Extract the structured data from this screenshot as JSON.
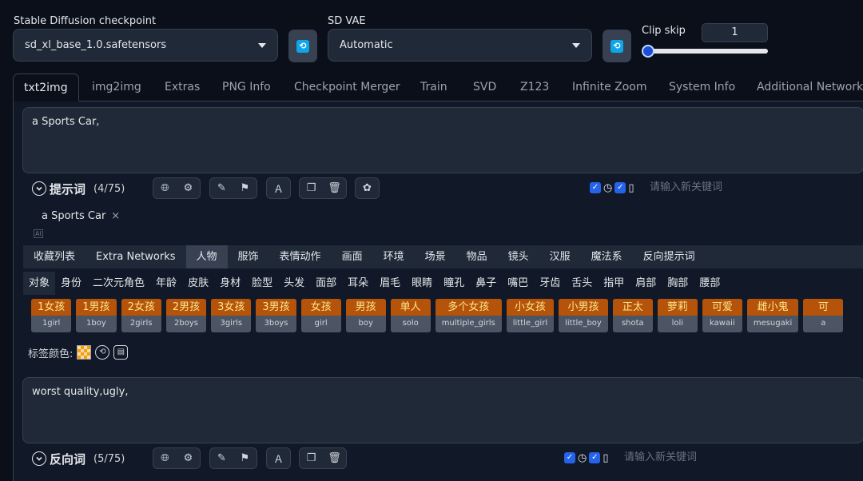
{
  "settings": {
    "checkpoint_label": "Stable Diffusion checkpoint",
    "checkpoint_value": "sd_xl_base_1.0.safetensors",
    "vae_label": "SD VAE",
    "vae_value": "Automatic",
    "clip_skip_label": "Clip skip",
    "clip_skip_value": "1",
    "clip_skip_fraction": 0.0
  },
  "tabs": [
    "txt2img",
    "img2img",
    "Extras",
    "PNG Info",
    "Checkpoint Merger",
    "Train",
    "SVD",
    "Z123",
    "Infinite Zoom",
    "System Info",
    "Additional Networks"
  ],
  "prompt": {
    "text": "a Sports Car,",
    "title": "提示词",
    "count": "(4/75)",
    "keyword_placeholder": "请输入新关键词",
    "tag_chip": "a Sports Car"
  },
  "categories": [
    "收藏列表",
    "Extra Networks",
    "人物",
    "服饰",
    "表情动作",
    "画面",
    "环境",
    "场景",
    "物品",
    "镜头",
    "汉服",
    "魔法系",
    "反向提示词"
  ],
  "subcategories": [
    "对象",
    "身份",
    "二次元角色",
    "年龄",
    "皮肤",
    "身材",
    "脸型",
    "头发",
    "面部",
    "耳朵",
    "眉毛",
    "眼睛",
    "瞳孔",
    "鼻子",
    "嘴巴",
    "牙齿",
    "舌头",
    "指甲",
    "肩部",
    "胸部",
    "腰部"
  ],
  "tag_buttons": [
    {
      "zh": "1女孩",
      "en": "1girl"
    },
    {
      "zh": "1男孩",
      "en": "1boy"
    },
    {
      "zh": "2女孩",
      "en": "2girls"
    },
    {
      "zh": "2男孩",
      "en": "2boys"
    },
    {
      "zh": "3女孩",
      "en": "3girls"
    },
    {
      "zh": "3男孩",
      "en": "3boys"
    },
    {
      "zh": "女孩",
      "en": "girl"
    },
    {
      "zh": "男孩",
      "en": "boy"
    },
    {
      "zh": "单人",
      "en": "solo"
    },
    {
      "zh": "多个女孩",
      "en": "multiple_girls"
    },
    {
      "zh": "小女孩",
      "en": "little_girl"
    },
    {
      "zh": "小男孩",
      "en": "little_boy"
    },
    {
      "zh": "正太",
      "en": "shota"
    },
    {
      "zh": "萝莉",
      "en": "loli"
    },
    {
      "zh": "可爱",
      "en": "kawaii"
    },
    {
      "zh": "雌小鬼",
      "en": "mesugaki"
    },
    {
      "zh": "可",
      "en": "a"
    }
  ],
  "tag_color_label": "标签颜色:",
  "negative": {
    "text": "worst quality,ugly,",
    "title": "反向词",
    "count": "(5/75)",
    "keyword_placeholder": "请输入新关键词"
  }
}
